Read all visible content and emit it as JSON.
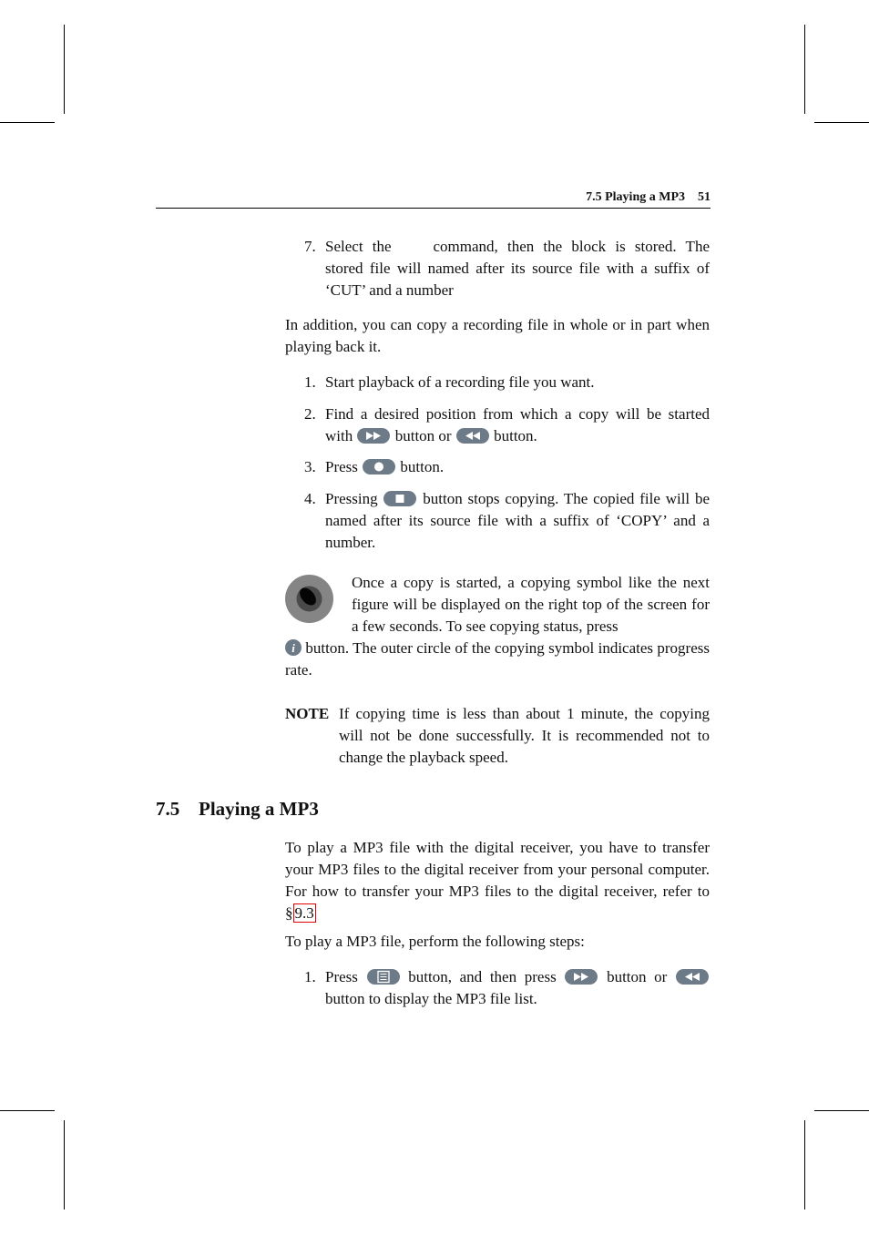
{
  "header": {
    "running_title": "7.5 Playing a MP3",
    "page_number": "51"
  },
  "top_list": {
    "item7": {
      "number": "7.",
      "text_before": "Select the",
      "text_after": "command, then the block is stored. The stored file will named after its source file with a suffix of ‘CUT’ and a number"
    }
  },
  "intro_copy": "In addition, you can copy a recording file in whole or in part when playing back it.",
  "copy_steps": [
    {
      "number": "1.",
      "text": "Start playback of a recording file you want."
    },
    {
      "number": "2.",
      "text_a": "Find a desired position from which a copy will be started with",
      "text_b": "button or",
      "text_c": "button."
    },
    {
      "number": "3.",
      "text_a": "Press",
      "text_b": "button."
    },
    {
      "number": "4.",
      "text_a": "Pressing",
      "text_b": "button stops copying. The copied file will be named after its source file with a suffix of ‘COPY’ and a number."
    }
  ],
  "tip": {
    "icon": "copying-symbol-icon",
    "text_a": "Once a copy is started, a copying symbol like the next figure will be displayed on the right top of the screen for a few seconds. To see copying status, press",
    "text_b": "button. The outer circle of the copying symbol indicates progress rate."
  },
  "note": {
    "label": "NOTE",
    "text": "If copying time is less than about 1 minute, the copying will not be done successfully. It is recommended not to change the playback speed."
  },
  "section": {
    "number": "7.5",
    "title": "Playing a MP3"
  },
  "mp3_intro": {
    "text_a": "To play a MP3 file with the digital receiver, you have to transfer your MP3 files to the digital receiver from your personal computer. For how to transfer your MP3 files to the digital receiver, refer to §",
    "ref": "9.3"
  },
  "mp3_steps_intro": "To play a MP3 file, perform the following steps:",
  "mp3_steps": [
    {
      "number": "1.",
      "text_a": "Press",
      "text_b": "button, and then press",
      "text_c": "button or",
      "text_d": "button to display the MP3 file list."
    }
  ],
  "colors": {
    "button_fill": "#6d7b88",
    "link_box": "#e00000"
  }
}
